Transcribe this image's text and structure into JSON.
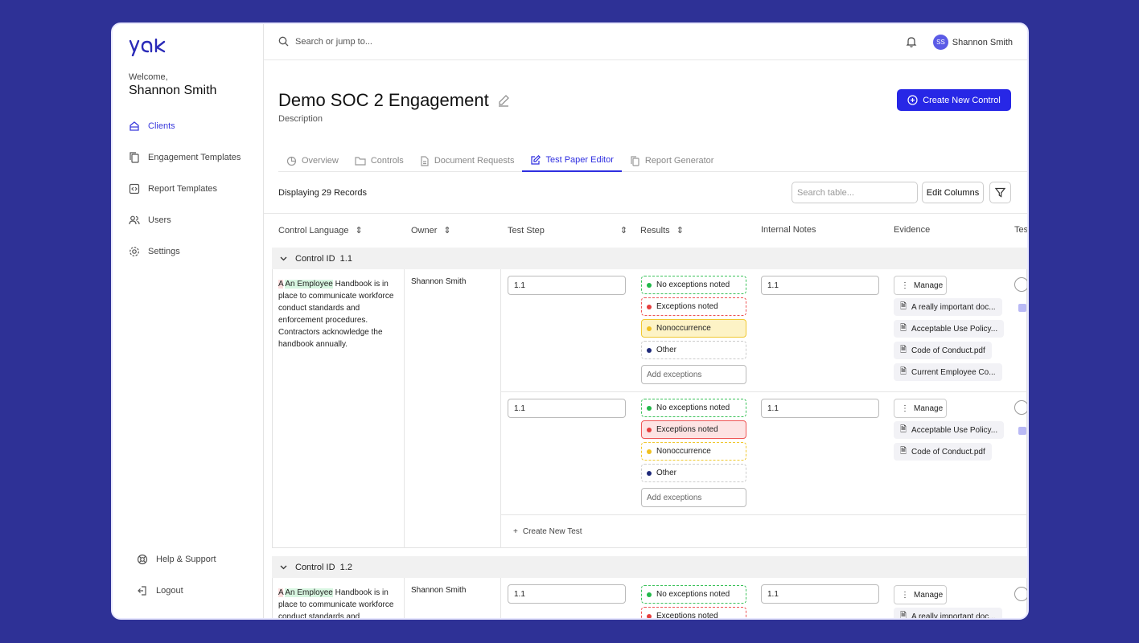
{
  "sidebar": {
    "logo_text": "yak",
    "welcome": "Welcome,",
    "user_name": "Shannon Smith",
    "items": [
      {
        "label": "Clients",
        "icon": "building-icon"
      },
      {
        "label": "Engagement Templates",
        "icon": "copy-icon"
      },
      {
        "label": "Report Templates",
        "icon": "code-file-icon"
      },
      {
        "label": "Users",
        "icon": "users-icon"
      },
      {
        "label": "Settings",
        "icon": "gear-icon"
      }
    ],
    "help": "Help & Support",
    "logout": "Logout"
  },
  "topbar": {
    "search_placeholder": "Search or jump to...",
    "avatar_initials": "SS",
    "user_name": "Shannon Smith"
  },
  "page": {
    "title": "Demo SOC 2 Engagement",
    "description": "Description",
    "create_button": "Create New Control"
  },
  "tabs": [
    {
      "label": "Overview"
    },
    {
      "label": "Controls"
    },
    {
      "label": "Document Requests"
    },
    {
      "label": "Test Paper Editor"
    },
    {
      "label": "Report Generator"
    }
  ],
  "table": {
    "records": "Displaying 29 Records",
    "search_placeholder": "Search table...",
    "edit_columns": "Edit Columns",
    "columns": [
      "Control Language",
      "Owner",
      "Test Step",
      "Results",
      "Internal Notes",
      "Evidence",
      "Tes"
    ],
    "groups": [
      {
        "label": "Control ID",
        "id": "1.1"
      },
      {
        "label": "Control ID",
        "id": "1.2"
      }
    ],
    "control_text": {
      "a": "A",
      "b": "An Employee",
      "rest1": " Handbook is in",
      "line2": "place to communicate workforce",
      "line3": "conduct standards and",
      "line4": "enforcement procedures.",
      "line5": "Contractors acknowledge the",
      "line6": "handbook annually."
    },
    "owner": "Shannon Smith",
    "test_step_value": "1.1",
    "notes_value": "1.1",
    "results": [
      "No exceptions noted",
      "Exceptions noted",
      "Nonoccurrence",
      "Other"
    ],
    "add_exceptions": "Add exceptions",
    "manage": "Manage",
    "files_row1": [
      "A really important doc...",
      "Acceptable Use Policy...",
      "Code of Conduct.pdf",
      "Current Employee Co..."
    ],
    "files_row2": [
      "Acceptable Use Policy...",
      "Code of Conduct.pdf"
    ],
    "files_row3": [
      "A really important doc..."
    ],
    "create_new_test": "Create New Test"
  },
  "colors": {
    "accent": "#2727e6",
    "background": "#2e3196",
    "green": "#22b84a",
    "red": "#e53e3e",
    "yellow": "#f0c020",
    "navy": "#1f2a7a"
  }
}
